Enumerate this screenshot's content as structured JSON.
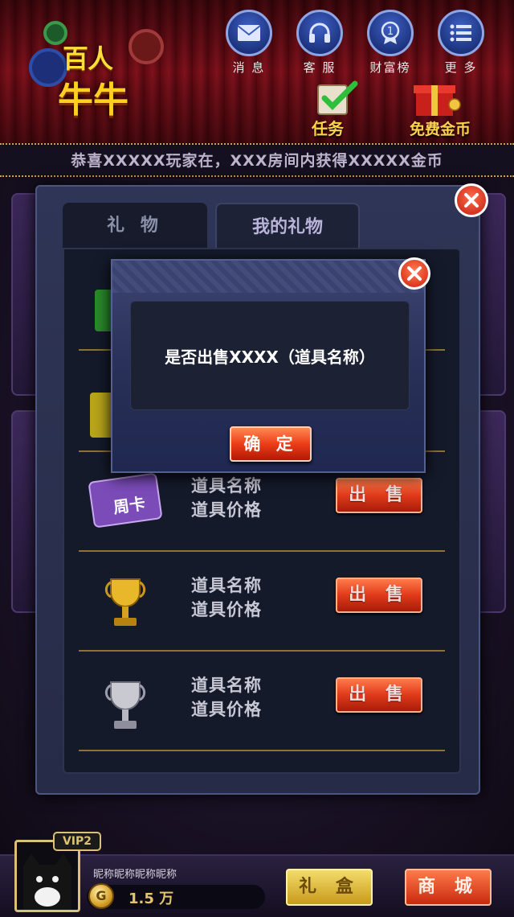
{
  "logo": {
    "line1": "百人",
    "line2": "牛牛"
  },
  "nav": [
    {
      "label": "消 息",
      "icon": "envelope-icon"
    },
    {
      "label": "客 服",
      "icon": "headset-icon"
    },
    {
      "label": "财富榜",
      "icon": "medal-icon"
    },
    {
      "label": "更 多",
      "icon": "list-icon"
    }
  ],
  "tasks": {
    "task_label": "任务",
    "free_gold_label": "免费金币"
  },
  "marquee": "恭喜XXXXX玩家在，XXX房间内获得XXXXX金币",
  "tabs": {
    "gift": "礼 物",
    "mine": "我的礼物"
  },
  "items": [
    {
      "name": "道具名称",
      "price": "道具价格",
      "sell": "出 售",
      "icon": "week-card-icon",
      "icon_text": "周卡"
    },
    {
      "name": "道具名称",
      "price": "道具价格",
      "sell": "出 售",
      "icon": "gold-trophy-icon"
    },
    {
      "name": "道具名称",
      "price": "道具价格",
      "sell": "出 售",
      "icon": "silver-trophy-icon"
    }
  ],
  "dialog": {
    "message": "是否出售XXXX（道具名称）",
    "confirm": "确 定"
  },
  "player": {
    "vip": "VIP2",
    "nickname": "昵称昵称昵称昵称",
    "gold": "1.5 万",
    "coin_symbol": "G"
  },
  "bottom": {
    "giftbox": "礼 盒",
    "mall": "商 城"
  },
  "colors": {
    "accent_red": "#e03a1a",
    "gold": "#e6c26a",
    "panel": "#262b47",
    "divider": "#8a7430"
  }
}
